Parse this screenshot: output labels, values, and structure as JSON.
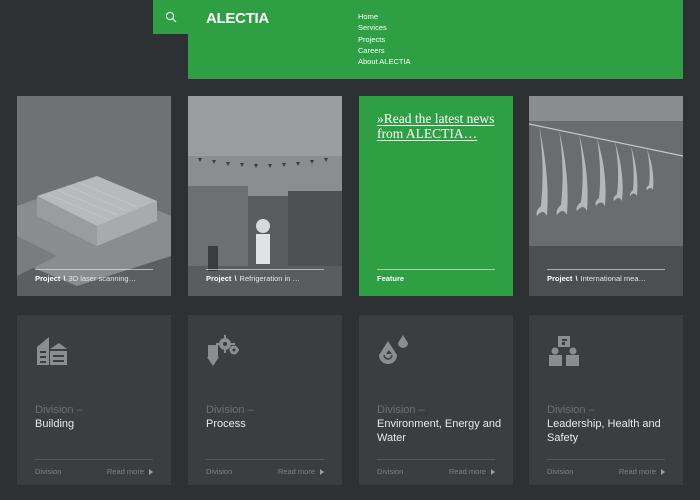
{
  "brand": {
    "logo": "ALECTIA",
    "accent": "#2ea043"
  },
  "search": {
    "icon": "search-icon"
  },
  "nav": {
    "items": [
      "Home",
      "Services",
      "Projects",
      "Careers",
      "About ALECTIA"
    ]
  },
  "cards": [
    {
      "type": "Project",
      "title": "3D laser scanning…"
    },
    {
      "type": "Project",
      "title": "Refrigeration in …"
    },
    {
      "type": "Feature",
      "headline": "»Read the latest news from ALECTIA…"
    },
    {
      "type": "Project",
      "title": "International mea…"
    }
  ],
  "divisions": [
    {
      "kicker": "Division –",
      "name": "Building",
      "foot": "Division",
      "more": "Read more",
      "icon": "building-icon"
    },
    {
      "kicker": "Division –",
      "name": "Process",
      "foot": "Division",
      "more": "Read more",
      "icon": "gears-icon"
    },
    {
      "kicker": "Division –",
      "name": "Environment, Energy and Water",
      "foot": "Division",
      "more": "Read more",
      "icon": "water-drop-icon"
    },
    {
      "kicker": "Division –",
      "name": "Leadership, Health and Safety",
      "foot": "Division",
      "more": "Read more",
      "icon": "people-icon"
    }
  ]
}
